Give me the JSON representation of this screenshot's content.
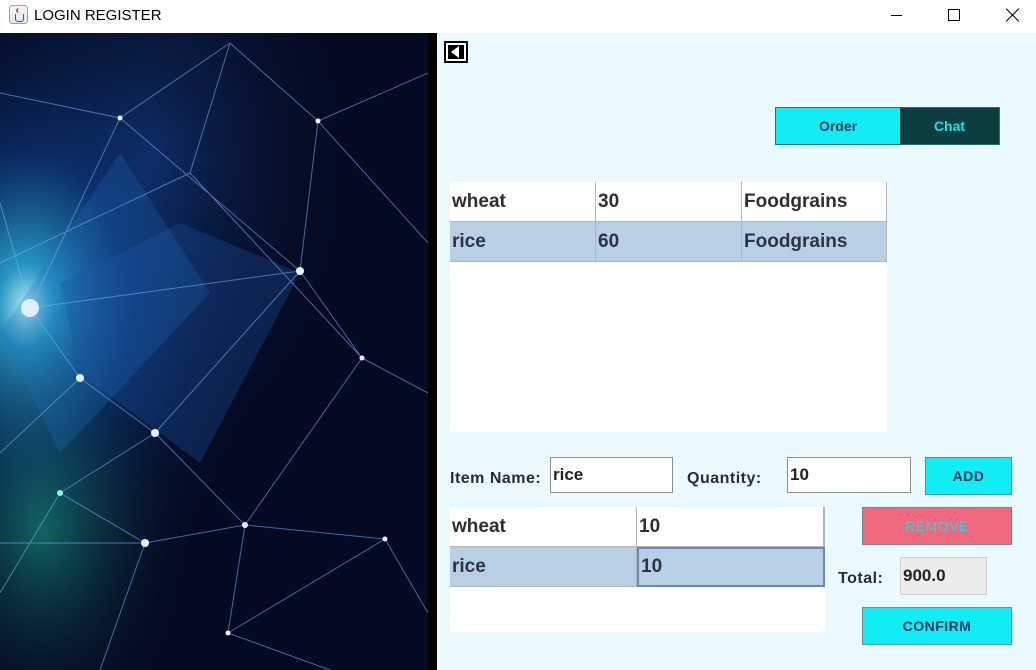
{
  "window": {
    "title": "LOGIN REGISTER",
    "controls": [
      "minimize",
      "maximize",
      "close"
    ]
  },
  "left_image": {
    "description_icon": "network-mesh-image"
  },
  "panel": {
    "back_icon": "back-arrow-icon",
    "tabs": [
      {
        "label": "Order",
        "active": true
      },
      {
        "label": "Chat",
        "active": false
      }
    ],
    "items_table": {
      "rows": [
        {
          "name": "wheat",
          "price": "30",
          "category": "Foodgrains",
          "selected": false
        },
        {
          "name": "rice",
          "price": "60",
          "category": "Foodgrains",
          "selected": true
        }
      ]
    },
    "form": {
      "item_label": "Item Name:",
      "item_value": "rice",
      "qty_label": "Quantity:",
      "qty_value": "10",
      "add_label": "ADD"
    },
    "order_table": {
      "rows": [
        {
          "name": "wheat",
          "qty": "10",
          "selected": false
        },
        {
          "name": "rice",
          "qty": "10",
          "selected": true
        }
      ]
    },
    "remove_label": "REMOVE",
    "total_label": "Total:",
    "total_value": "900.0",
    "confirm_label": "CONFIRM"
  },
  "colors": {
    "panel_bg": "#eafaff",
    "accent_cyan": "#10edf5",
    "chat_tab_bg": "#0d3e3f",
    "remove_bg": "#f0687d",
    "selected_row": "#b9cfe6"
  }
}
